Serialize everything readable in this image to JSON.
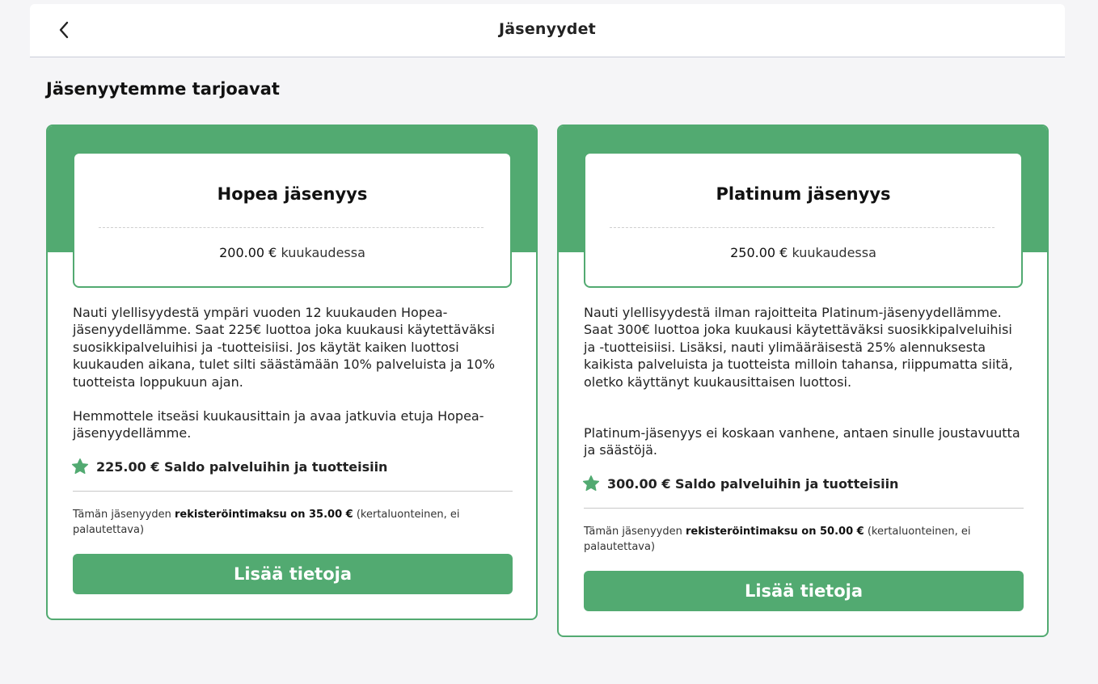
{
  "header": {
    "title": "Jäsenyydet",
    "back_icon": "chevron-left-icon"
  },
  "section": {
    "title": "Jäsenyytemme tarjoavat"
  },
  "colors": {
    "accent": "#52aa71",
    "background": "#f5f5f7"
  },
  "cards": [
    {
      "name": "Hopea jäsenyys",
      "price_amount": "200.00 €",
      "price_period": "kuukaudessa",
      "description_1": "Nauti ylellisyydestä ympäri vuoden 12 kuukauden Hopea-jäsenyydellämme. Saat 225€ luottoa joka kuukausi käytettäväksi suosikkipalveluihisi ja -tuotteisiisi. Jos käytät kaiken luottosi kuukauden aikana, tulet silti säästämään 10% palveluista ja 10% tuotteista loppukuun ajan.",
      "description_2": "Hemmottele itseäsi kuukausittain ja avaa jatkuvia etuja Hopea-jäsenyydellämme.",
      "credit": "225.00 € Saldo palveluihin ja tuotteisiin",
      "credit_icon": "star-icon",
      "fee_prefix": "Tämän jäsenyyden ",
      "fee_bold": "rekisteröintimaksu on 35.00 €",
      "fee_suffix": " (kertaluonteinen, ei palautettava)",
      "button_label": "Lisää tietoja"
    },
    {
      "name": "Platinum jäsenyys",
      "price_amount": "250.00 €",
      "price_period": "kuukaudessa",
      "description_1": "Nauti ylellisyydestä ilman rajoitteita Platinum-jäsenyydellämme. Saat 300€ luottoa joka kuukausi käytettäväksi suosikkipalveluihisi ja -tuotteisiisi. Lisäksi, nauti ylimääräisestä 25% alennuksesta kaikista palveluista ja tuotteista milloin tahansa, riippumatta siitä, oletko käyttänyt kuukausittaisen luottosi.",
      "description_2": "Platinum-jäsenyys ei koskaan vanhene, antaen sinulle joustavuutta ja säästöjä.",
      "credit": "300.00 € Saldo palveluihin ja tuotteisiin",
      "credit_icon": "star-icon",
      "fee_prefix": "Tämän jäsenyyden ",
      "fee_bold": "rekisteröintimaksu on 50.00 €",
      "fee_suffix": " (kertaluonteinen, ei palautettava)",
      "button_label": "Lisää tietoja"
    }
  ]
}
